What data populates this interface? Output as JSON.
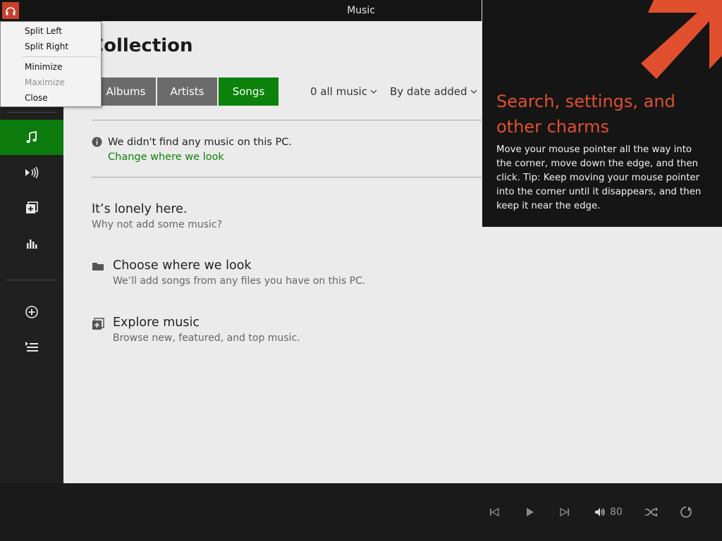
{
  "window": {
    "title": "Music"
  },
  "context_menu": {
    "items": [
      {
        "label": "Split Left",
        "enabled": true
      },
      {
        "label": "Split Right",
        "enabled": true
      },
      {
        "label": "Minimize",
        "enabled": true
      },
      {
        "label": "Maximize",
        "enabled": false
      },
      {
        "label": "Close",
        "enabled": true
      }
    ]
  },
  "sidebar": {
    "items": [
      {
        "icon": "music-note-icon",
        "active": true
      },
      {
        "icon": "radio-icon",
        "active": false
      },
      {
        "icon": "explore-icon",
        "active": false
      },
      {
        "icon": "equalizer-icon",
        "active": false
      },
      {
        "icon": "add-circle-icon",
        "active": false
      },
      {
        "icon": "playlist-icon",
        "active": false
      }
    ]
  },
  "main": {
    "title": "Collection",
    "tabs": [
      "Albums",
      "Artists",
      "Songs"
    ],
    "selected_tab": "Songs",
    "filter_label": "0 all music",
    "sort_label": "By date added",
    "info_message": "We didn't find any music on this PC.",
    "info_link": "Change where we look",
    "lonely_title": "It’s lonely here.",
    "lonely_subtitle": "Why not add some music?",
    "actions": [
      {
        "title": "Choose where we look",
        "subtitle": "We’ll add songs from any files you have on this PC.",
        "icon": "folder-icon"
      },
      {
        "title": "Explore music",
        "subtitle": "Browse new, featured, and top music.",
        "icon": "explore-icon"
      }
    ]
  },
  "charm_tip": {
    "title": "Search, settings, and other charms",
    "body": "Move your mouse pointer all the way into the corner, move down the edge, and then click. Tip: Keep moving your mouse pointer into the corner until it disappears, and then keep it near the edge."
  },
  "player": {
    "volume": "80"
  },
  "colors": {
    "accent_green": "#0c820c",
    "charm_orange": "#e0502e",
    "tab_grey": "#6b6b6b"
  }
}
